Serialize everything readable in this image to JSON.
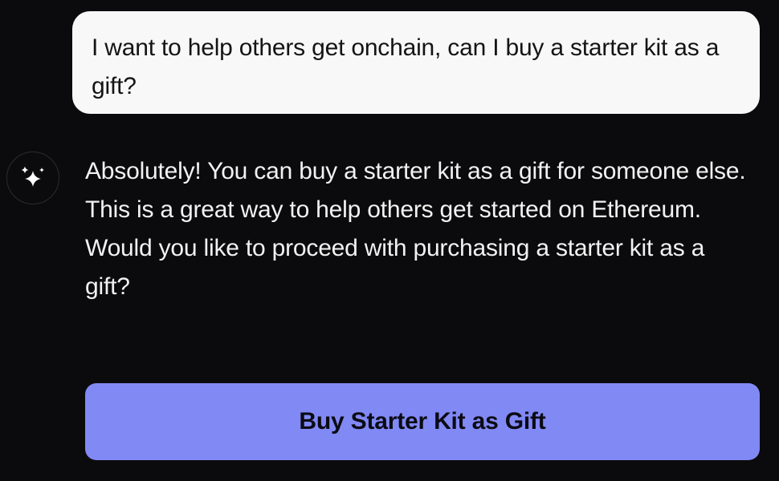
{
  "conversation": {
    "user_message": "I want to help others get onchain, can I buy a starter kit as a gift?",
    "assistant": {
      "avatar_icon": "sparkles-icon",
      "message": "Absolutely! You can buy a starter kit as a gift for someone else. This is a great way to help others get started on Ethereum. Would you like to proceed with purchasing a starter kit as a gift?"
    },
    "action_button_label": "Buy Starter Kit as Gift"
  },
  "colors": {
    "background": "#0b0b0d",
    "user_bubble": "#f8f8f8",
    "user_text": "#141414",
    "assistant_text": "#f2f2f2",
    "button_background": "#8189f5",
    "button_text": "#0b0b14"
  }
}
